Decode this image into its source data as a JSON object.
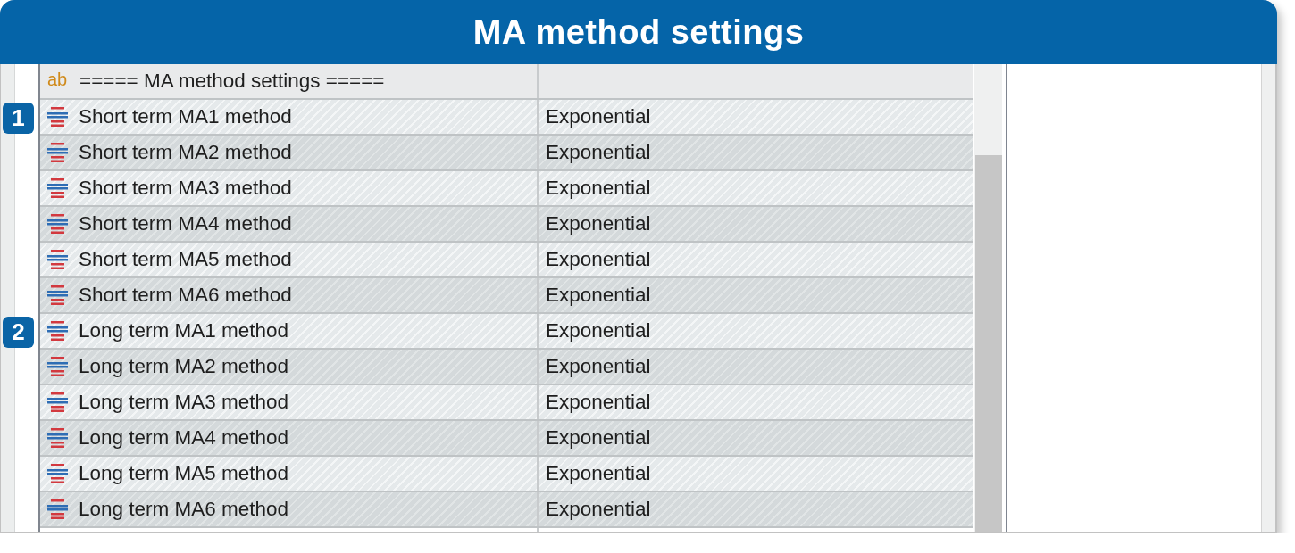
{
  "header": {
    "title": "MA method settings"
  },
  "parameters": [
    {
      "kind": "string",
      "type_icon": "ab",
      "name": "===== MA method settings ====="
    },
    {
      "kind": "enum",
      "marker": "1",
      "name": "Short term MA1 method",
      "value": "Exponential"
    },
    {
      "kind": "enum",
      "name": "Short term MA2 method",
      "value": "Exponential"
    },
    {
      "kind": "enum",
      "name": "Short term MA3 method",
      "value": "Exponential"
    },
    {
      "kind": "enum",
      "name": "Short term MA4 method",
      "value": "Exponential"
    },
    {
      "kind": "enum",
      "name": "Short term MA5 method",
      "value": "Exponential"
    },
    {
      "kind": "enum",
      "name": "Short term MA6 method",
      "value": "Exponential"
    },
    {
      "kind": "enum",
      "marker": "2",
      "name": "Long term MA1 method",
      "value": "Exponential"
    },
    {
      "kind": "enum",
      "name": "Long term MA2 method",
      "value": "Exponential"
    },
    {
      "kind": "enum",
      "name": "Long term MA3 method",
      "value": "Exponential"
    },
    {
      "kind": "enum",
      "name": "Long term MA4 method",
      "value": "Exponential"
    },
    {
      "kind": "enum",
      "name": "Long term MA5 method",
      "value": "Exponential"
    },
    {
      "kind": "enum",
      "name": "Long term MA6 method",
      "value": "Exponential"
    }
  ]
}
